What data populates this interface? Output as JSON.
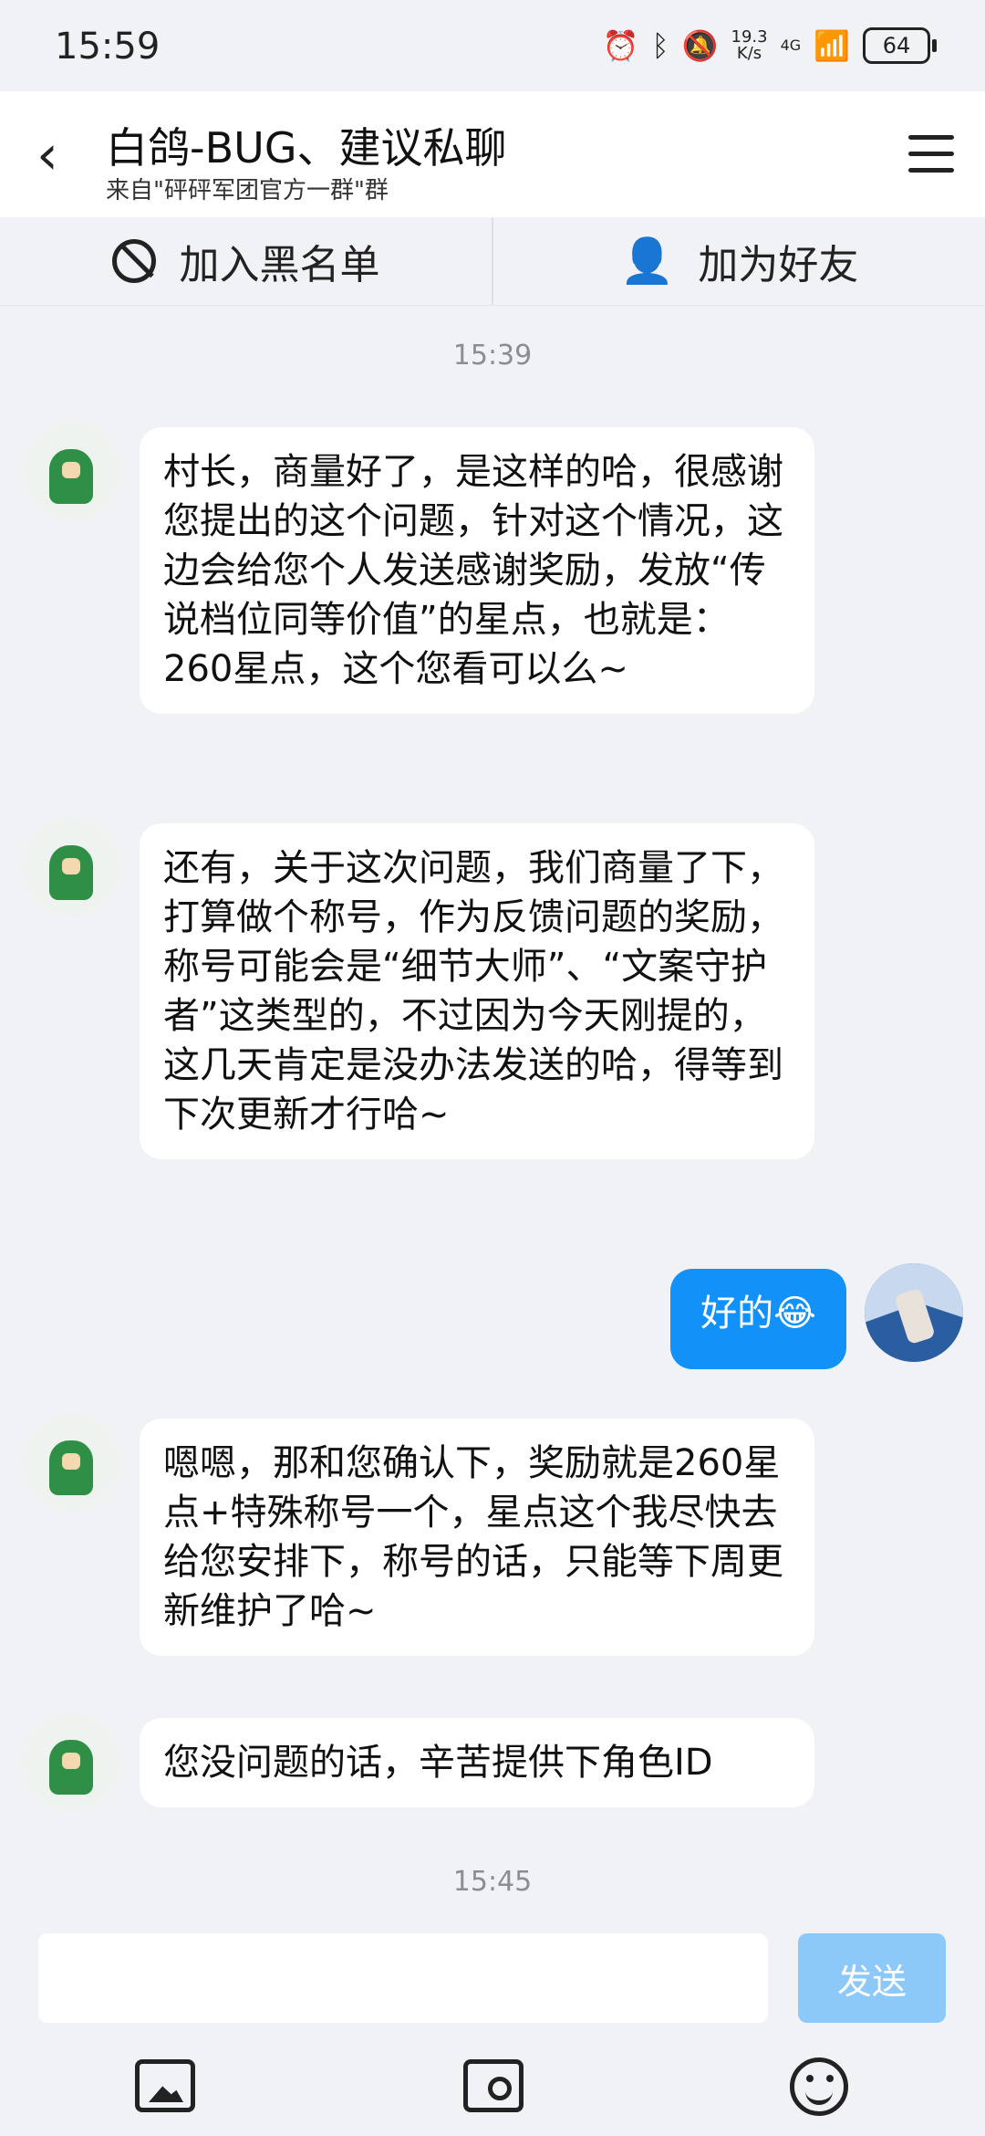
{
  "status_bar": {
    "time": "15:59",
    "net_speed": "19.3\nK/s",
    "signal": "4G",
    "battery": "64"
  },
  "header": {
    "title": "白鸽-BUG、建议私聊",
    "subtitle": "来自\"砰砰军团官方一群\"群"
  },
  "actions": {
    "block_label": "加入黑名单",
    "add_friend_label": "加为好友"
  },
  "timestamps": [
    "15:39",
    "15:45"
  ],
  "messages": [
    {
      "from": "other",
      "text": "村长，商量好了，是这样的哈，很感谢您提出的这个问题，针对这个情况，这边会给您个人发送感谢奖励，发放“传说档位同等价值”的星点，也就是：260星点，这个您看可以么~"
    },
    {
      "from": "other",
      "text": "还有，关于这次问题，我们商量了下，打算做个称号，作为反馈问题的奖励，称号可能会是“细节大师”、“文案守护者”这类型的，不过因为今天刚提的，这几天肯定是没办法发送的哈，得等到下次更新才行哈~"
    },
    {
      "from": "me",
      "text": "好的😂"
    },
    {
      "from": "other",
      "text": "嗯嗯，那和您确认下，奖励就是260星点+特殊称号一个，星点这个我尽快去给您安排下，称号的话，只能等下周更新维护了哈~"
    },
    {
      "from": "other",
      "text": "您没问题的话，辛苦提供下角色ID"
    }
  ],
  "composer": {
    "placeholder": "",
    "send_label": "发送"
  },
  "toolbar_icons": [
    "image-icon",
    "camera-icon",
    "emoji-icon"
  ],
  "colors": {
    "accent": "#1291f8",
    "send_disabled": "#8cc8f8",
    "background": "#f1f2f6"
  }
}
